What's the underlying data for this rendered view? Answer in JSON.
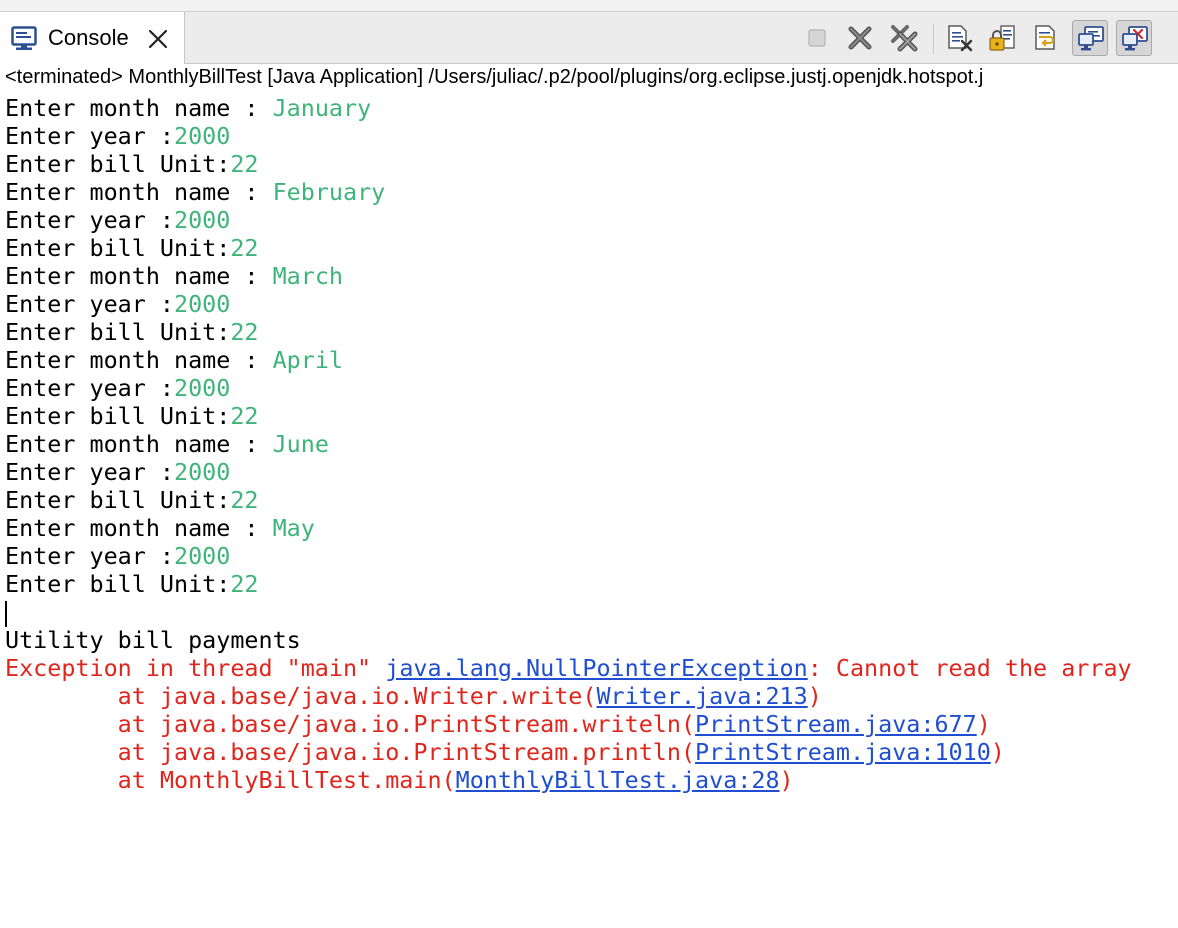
{
  "tab": {
    "label": "Console",
    "icon": "console-icon"
  },
  "toolbar": {
    "buttons": [
      {
        "name": "terminate-button",
        "icon": "stop-icon"
      },
      {
        "name": "remove-launch-button",
        "icon": "remove-x-icon"
      },
      {
        "name": "remove-all-terminated-button",
        "icon": "remove-all-x-icon"
      },
      {
        "name": "clear-console-button",
        "icon": "clear-console-icon"
      },
      {
        "name": "scroll-lock-button",
        "icon": "scroll-lock-icon"
      },
      {
        "name": "word-wrap-button",
        "icon": "word-wrap-icon"
      },
      {
        "name": "show-on-stdout-button",
        "icon": "display-console-icon"
      },
      {
        "name": "show-on-stderr-button",
        "icon": "display-console-error-icon"
      }
    ]
  },
  "status": "<terminated> MonthlyBillTest [Java Application] /Users/juliac/.p2/pool/plugins/org.eclipse.justj.openjdk.hotspot.j",
  "console": {
    "entries": [
      {
        "month_prompt": "Enter month name : ",
        "month": "January",
        "year_prompt": "Enter year :",
        "year": "2000",
        "unit_prompt": "Enter bill Unit:",
        "unit": "22"
      },
      {
        "month_prompt": "Enter month name : ",
        "month": "February",
        "year_prompt": "Enter year :",
        "year": "2000",
        "unit_prompt": "Enter bill Unit:",
        "unit": "22"
      },
      {
        "month_prompt": "Enter month name : ",
        "month": "March",
        "year_prompt": "Enter year :",
        "year": "2000",
        "unit_prompt": "Enter bill Unit:",
        "unit": "22"
      },
      {
        "month_prompt": "Enter month name : ",
        "month": "April",
        "year_prompt": "Enter year :",
        "year": "2000",
        "unit_prompt": "Enter bill Unit:",
        "unit": "22"
      },
      {
        "month_prompt": "Enter month name : ",
        "month": "June",
        "year_prompt": "Enter year :",
        "year": "2000",
        "unit_prompt": "Enter bill Unit:",
        "unit": "22"
      },
      {
        "month_prompt": "Enter month name : ",
        "month": "May",
        "year_prompt": "Enter year :",
        "year": "2000",
        "unit_prompt": "Enter bill Unit:",
        "unit": "22"
      }
    ],
    "heading": "Utility bill payments",
    "exception": {
      "prefix": "Exception in thread \"main\" ",
      "class_link": "java.lang.NullPointerException",
      "message": ": Cannot read the array "
    },
    "stack": [
      {
        "prefix": "        at java.base/java.io.Writer.write(",
        "link": "Writer.java:213",
        "suffix": ")"
      },
      {
        "prefix": "        at java.base/java.io.PrintStream.writeln(",
        "link": "PrintStream.java:677",
        "suffix": ")"
      },
      {
        "prefix": "        at java.base/java.io.PrintStream.println(",
        "link": "PrintStream.java:1010",
        "suffix": ")"
      },
      {
        "prefix": "        at MonthlyBillTest.main(",
        "link": "MonthlyBillTest.java:28",
        "suffix": ")"
      }
    ]
  },
  "colors": {
    "input_text": "#3fb47a",
    "error_text": "#e0261c",
    "link_text": "#1f4fd0"
  }
}
